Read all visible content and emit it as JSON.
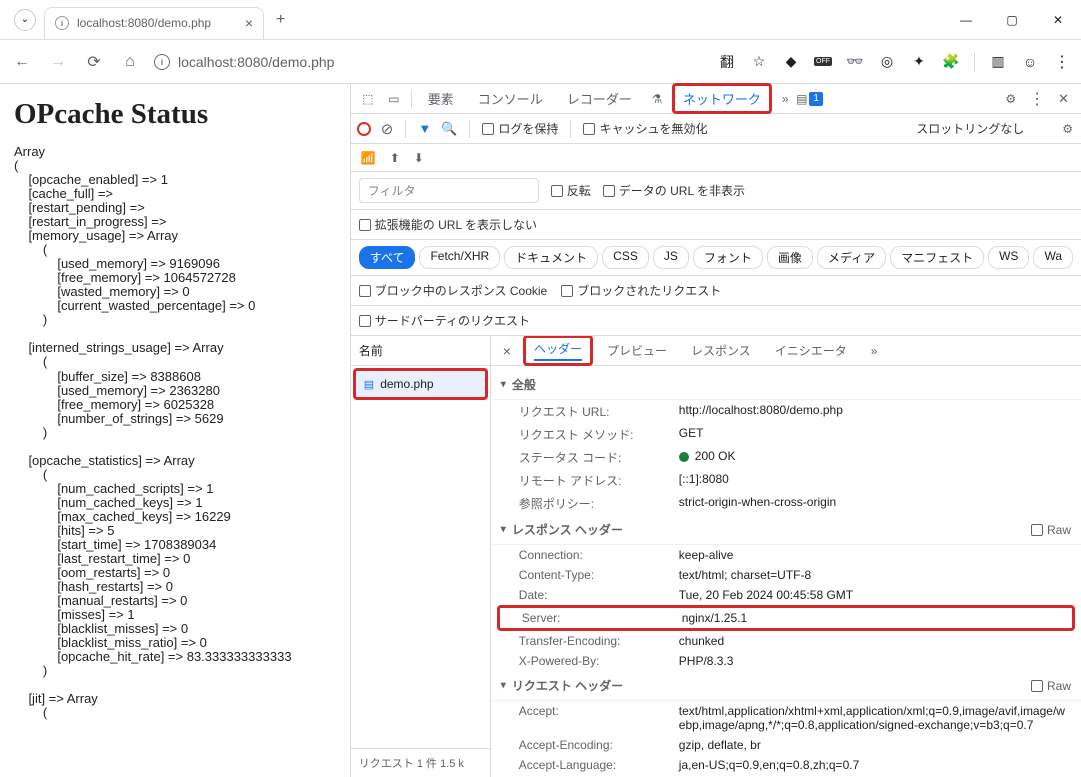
{
  "browser": {
    "tab_title": "localhost:8080/demo.php",
    "url": "localhost:8080/demo.php",
    "new_tab": "+",
    "close_tab": "×",
    "window": {
      "min": "—",
      "max": "▢",
      "close": "✕"
    },
    "toolbar_icons": [
      "翻",
      "☆"
    ]
  },
  "page": {
    "heading": "OPcache Status",
    "dump": "Array\n(\n    [opcache_enabled] => 1\n    [cache_full] =>\n    [restart_pending] =>\n    [restart_in_progress] =>\n    [memory_usage] => Array\n        (\n            [used_memory] => 9169096\n            [free_memory] => 1064572728\n            [wasted_memory] => 0\n            [current_wasted_percentage] => 0\n        )\n\n    [interned_strings_usage] => Array\n        (\n            [buffer_size] => 8388608\n            [used_memory] => 2363280\n            [free_memory] => 6025328\n            [number_of_strings] => 5629\n        )\n\n    [opcache_statistics] => Array\n        (\n            [num_cached_scripts] => 1\n            [num_cached_keys] => 1\n            [max_cached_keys] => 16229\n            [hits] => 5\n            [start_time] => 1708389034\n            [last_restart_time] => 0\n            [oom_restarts] => 0\n            [hash_restarts] => 0\n            [manual_restarts] => 0\n            [misses] => 1\n            [blacklist_misses] => 0\n            [blacklist_miss_ratio] => 0\n            [opcache_hit_rate] => 83.333333333333\n        )\n\n    [jit] => Array\n        ("
  },
  "devtools": {
    "tabs": {
      "elements": "要素",
      "console": "コンソール",
      "recorder": "レコーダー",
      "network": "ネットワーク"
    },
    "overflow": "»",
    "issues_count": "1",
    "toolbar": {
      "preserve_log": "ログを保持",
      "disable_cache": "キャッシュを無効化",
      "throttling": "スロットリングなし"
    },
    "filter": {
      "placeholder": "フィルタ",
      "invert": "反転",
      "data_url": "データの URL を非表示"
    },
    "ext_url": "拡張機能の URL を表示しない",
    "types": [
      "すべて",
      "Fetch/XHR",
      "ドキュメント",
      "CSS",
      "JS",
      "フォント",
      "画像",
      "メディア",
      "マニフェスト",
      "WS",
      "Wa"
    ],
    "blocked_cookie": "ブロック中のレスポンス Cookie",
    "blocked_req": "ブロックされたリクエスト",
    "third_party": "サードパーティのリクエスト",
    "list": {
      "header": "名前",
      "item": "demo.php",
      "footer": "リクエスト 1 件    1.5 k"
    },
    "details": {
      "tabs": {
        "headers": "ヘッダー",
        "preview": "プレビュー",
        "response": "レスポンス",
        "initiator": "イニシエータ"
      },
      "overflow": "»",
      "general": {
        "title": "全般",
        "url_label": "リクエスト URL:",
        "url_val": "http://localhost:8080/demo.php",
        "method_label": "リクエスト メソッド:",
        "method_val": "GET",
        "status_label": "ステータス コード:",
        "status_val": "200 OK",
        "remote_label": "リモート アドレス:",
        "remote_val": "[::1]:8080",
        "policy_label": "参照ポリシー:",
        "policy_val": "strict-origin-when-cross-origin"
      },
      "response_headers": {
        "title": "レスポンス ヘッダー",
        "raw": "Raw",
        "connection_k": "Connection:",
        "connection_v": "keep-alive",
        "contenttype_k": "Content-Type:",
        "contenttype_v": "text/html; charset=UTF-8",
        "date_k": "Date:",
        "date_v": "Tue, 20 Feb 2024 00:45:58 GMT",
        "server_k": "Server:",
        "server_v": "nginx/1.25.1",
        "te_k": "Transfer-Encoding:",
        "te_v": "chunked",
        "xpb_k": "X-Powered-By:",
        "xpb_v": "PHP/8.3.3"
      },
      "request_headers": {
        "title": "リクエスト ヘッダー",
        "raw": "Raw",
        "accept_k": "Accept:",
        "accept_v": "text/html,application/xhtml+xml,application/xml;q=0.9,image/avif,image/webp,image/apng,*/*;q=0.8,application/signed-exchange;v=b3;q=0.7",
        "ae_k": "Accept-Encoding:",
        "ae_v": "gzip, deflate, br",
        "al_k": "Accept-Language:",
        "al_v": "ja,en-US;q=0.9,en;q=0.8,zh;q=0.7"
      }
    }
  }
}
